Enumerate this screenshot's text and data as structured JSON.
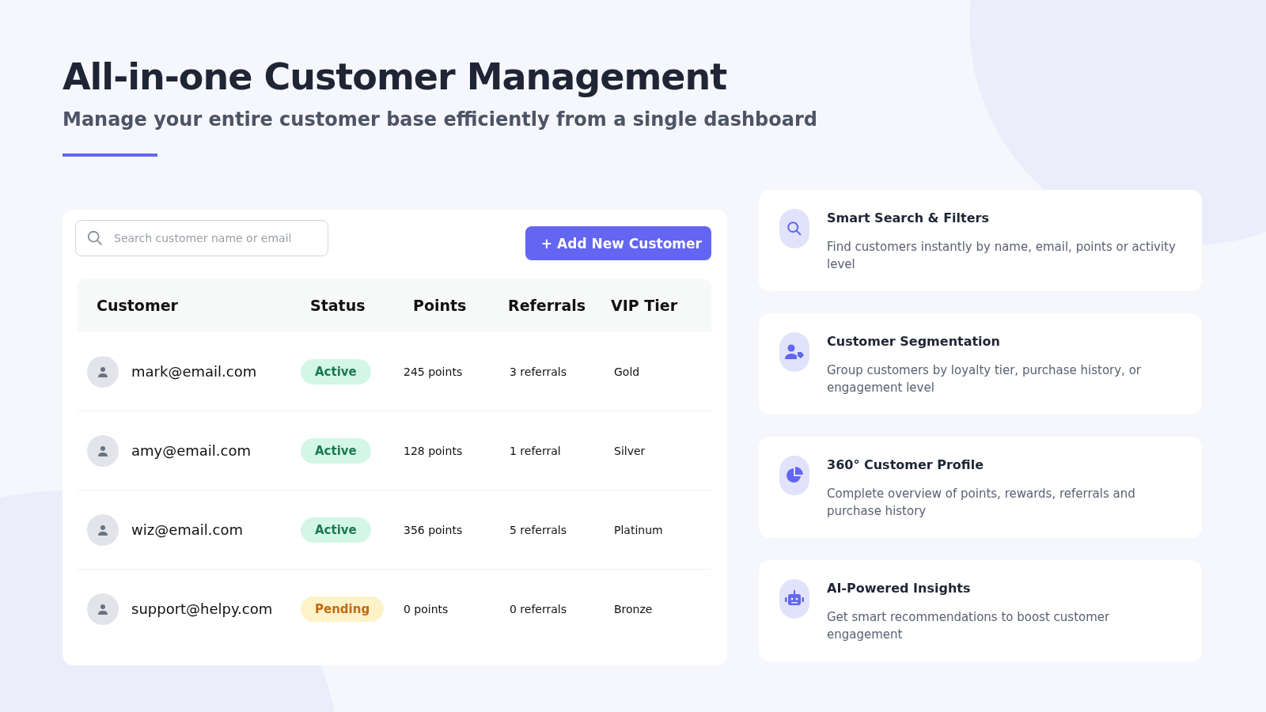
{
  "title": "All-in-one Customer Management",
  "subtitle": "Manage your entire customer base efficiently from a single dashboard",
  "search": {
    "placeholder": "Search customer name or email"
  },
  "add_button": {
    "icon": "+",
    "label": "Add New Customer"
  },
  "table": {
    "columns": [
      "Customer",
      "Status",
      "Points",
      "Referrals",
      "VIP Tier"
    ],
    "rows": [
      {
        "email": "mark@email.com",
        "status": {
          "label": "Active",
          "kind": "active"
        },
        "points": "245 points",
        "referrals": "3 referrals",
        "tier": "Gold"
      },
      {
        "email": "amy@email.com",
        "status": {
          "label": "Active",
          "kind": "active"
        },
        "points": "128 points",
        "referrals": "1 referral",
        "tier": "Silver"
      },
      {
        "email": "wiz@email.com",
        "status": {
          "label": "Active",
          "kind": "active"
        },
        "points": "356 points",
        "referrals": "5 referrals",
        "tier": "Platinum"
      },
      {
        "email": "support@helpy.com",
        "status": {
          "label": "Pending",
          "kind": "pending"
        },
        "points": "0 points",
        "referrals": "0 referrals",
        "tier": "Bronze"
      }
    ]
  },
  "features": [
    {
      "title": "Smart Search & Filters",
      "text": "Find customers instantly by name, email, points or activity level"
    },
    {
      "title": "Customer Segmentation",
      "text": "Group customers by loyalty tier, purchase history, or engagement level"
    },
    {
      "title": "360° Customer Profile",
      "text": "Complete overview of points, rewards, referrals and purchase history"
    },
    {
      "title": "AI-Powered Insights",
      "text": "Get smart recommendations to boost customer engagement"
    }
  ]
}
